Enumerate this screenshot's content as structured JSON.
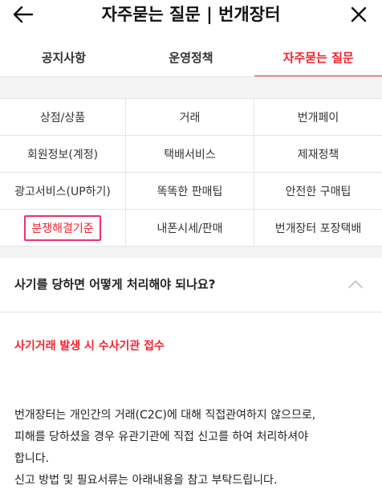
{
  "header": {
    "title": "자주묻는 질문 | 번개장터",
    "back_icon": "arrow-left-icon",
    "close_icon": "close-icon"
  },
  "tabs": [
    {
      "label": "공지사항",
      "active": false
    },
    {
      "label": "운영정책",
      "active": false
    },
    {
      "label": "자주묻는 질문",
      "active": true
    }
  ],
  "categories": [
    "상점/상품",
    "거래",
    "번개페이",
    "회원정보(계정)",
    "택배서비스",
    "제재정책",
    "광고서비스(UP하기)",
    "똑똑한 판매팁",
    "안전한 구매팁",
    "분쟁해결기준",
    "내폰시세/판매",
    "번개장터 포장택배"
  ],
  "active_category": "분쟁해결기준",
  "faq": {
    "question": "사기를 당하면 어떻게 처리해야 되나요?",
    "expanded": true,
    "chevron_icon": "chevron-up-icon",
    "answer_heading": "사기거래 발생 시 수사기관 접수",
    "answer_lines": [
      "번개장터는 개인간의 거래(C2C)에 대해 직접관여하지 않으므로,",
      "피해를 당하셨을 경우 유관기관에 직접 신고를 하여 처리하셔야",
      "합니다.",
      "신고 방법 및 필요서류는 아래내용을 참고 부탁드립니다."
    ]
  },
  "colors": {
    "accent": "#f5222d",
    "highlight_border": "#f0306a",
    "divider": "#e4e4e4",
    "gap_background": "#f4f4f4"
  }
}
